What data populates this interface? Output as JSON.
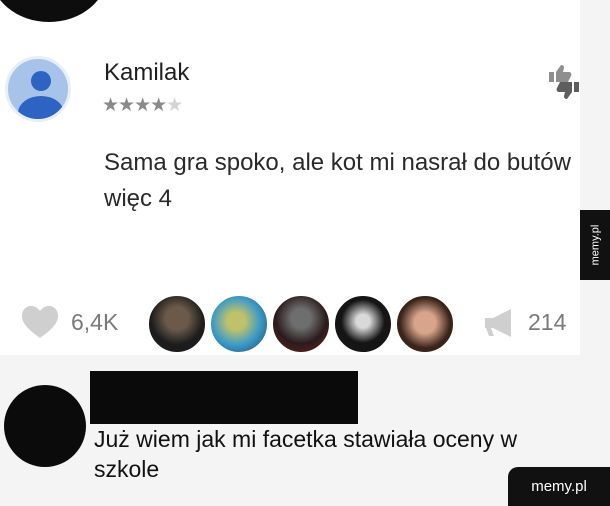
{
  "review": {
    "author": "Kamilak",
    "rating": 4,
    "rating_max": 5,
    "stars_filled": "★★★★",
    "stars_empty": "★",
    "text": "Sama gra spoko, ale kot mi nasrał do butów więc 4"
  },
  "reactions": {
    "likes": "6,4K",
    "shares": "214"
  },
  "reply": {
    "text": "Już wiem jak mi facetka stawiała oceny w szkole"
  },
  "watermarks": {
    "side": "memy.pl",
    "corner": "memy.pl"
  },
  "colors": {
    "avatar_bg": "#a8c3ea",
    "avatar_fg": "#2d63c2",
    "panel_bg": "#ffffff",
    "page_bg": "#f4f4f4"
  },
  "icons": [
    "thumbs-up-down-icon",
    "heart-icon",
    "megaphone-icon",
    "default-avatar-icon"
  ]
}
